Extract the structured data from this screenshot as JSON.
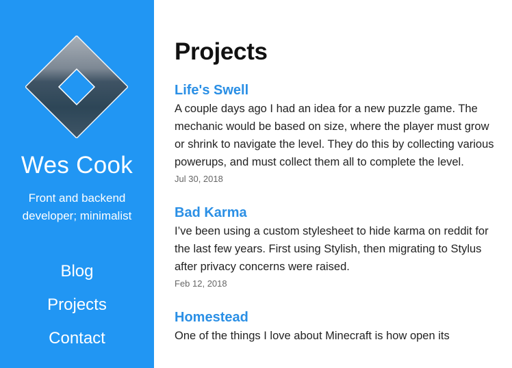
{
  "sidebar": {
    "logo": "diamond-logo-icon",
    "site_name": "Wes Cook",
    "tagline": "Front and backend developer; minimalist",
    "nav": [
      {
        "label": "Blog"
      },
      {
        "label": "Projects"
      },
      {
        "label": "Contact"
      }
    ],
    "background_color": "#2196f3"
  },
  "main": {
    "title": "Projects",
    "posts": [
      {
        "title": "Life's Swell",
        "excerpt": "A couple days ago I had an idea for a new puzzle game. The mechanic would be based on size, where the player must grow or shrink to navigate the level. They do this by collecting various powerups, and must collect them all to complete the level.",
        "date": "Jul 30, 2018"
      },
      {
        "title": "Bad Karma",
        "excerpt": "I’ve been using a custom stylesheet to hide karma on reddit for the last few years. First using Stylish, then migrating to Stylus after privacy concerns were raised.",
        "date": "Feb 12, 2018"
      },
      {
        "title": "Homestead",
        "excerpt": "One of the things I love about Minecraft is how open its"
      }
    ],
    "link_color": "#2a8fe5"
  }
}
